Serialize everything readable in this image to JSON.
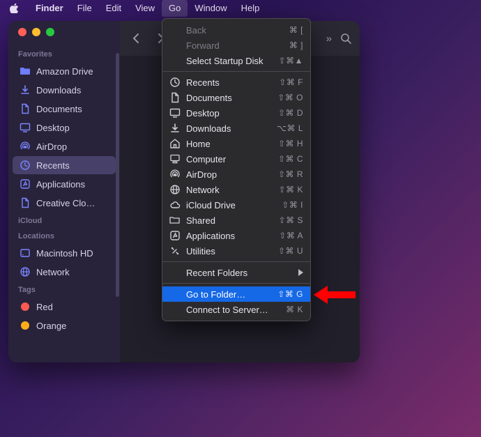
{
  "menubar": {
    "app": "Finder",
    "items": [
      "File",
      "Edit",
      "View",
      "Go",
      "Window",
      "Help"
    ],
    "open": "Go"
  },
  "sidebar": {
    "sections": [
      {
        "title": "Favorites",
        "items": [
          {
            "label": "Amazon Drive",
            "icon": "folder"
          },
          {
            "label": "Downloads",
            "icon": "download"
          },
          {
            "label": "Documents",
            "icon": "document"
          },
          {
            "label": "Desktop",
            "icon": "desktop"
          },
          {
            "label": "AirDrop",
            "icon": "airdrop"
          },
          {
            "label": "Recents",
            "icon": "clock",
            "selected": true
          },
          {
            "label": "Applications",
            "icon": "app"
          },
          {
            "label": "Creative Clo…",
            "icon": "document"
          }
        ]
      },
      {
        "title": "iCloud",
        "items": []
      },
      {
        "title": "Locations",
        "items": [
          {
            "label": "Macintosh HD",
            "icon": "disk"
          },
          {
            "label": "Network",
            "icon": "network"
          }
        ]
      },
      {
        "title": "Tags",
        "items": [
          {
            "label": "Red",
            "icon": "tag",
            "color": "#ff5a52"
          },
          {
            "label": "Orange",
            "icon": "tag",
            "color": "#ffae1a"
          }
        ]
      }
    ]
  },
  "dropdown": {
    "groups": [
      [
        {
          "label": "Back",
          "shortcut": "⌘ [",
          "disabled": true,
          "icon": ""
        },
        {
          "label": "Forward",
          "shortcut": "⌘ ]",
          "disabled": true,
          "icon": ""
        },
        {
          "label": "Select Startup Disk",
          "shortcut": "⇧⌘▲",
          "icon": ""
        }
      ],
      [
        {
          "label": "Recents",
          "shortcut": "⇧⌘ F",
          "icon": "clock"
        },
        {
          "label": "Documents",
          "shortcut": "⇧⌘ O",
          "icon": "document"
        },
        {
          "label": "Desktop",
          "shortcut": "⇧⌘ D",
          "icon": "desktop"
        },
        {
          "label": "Downloads",
          "shortcut": "⌥⌘ L",
          "icon": "download"
        },
        {
          "label": "Home",
          "shortcut": "⇧⌘ H",
          "icon": "home"
        },
        {
          "label": "Computer",
          "shortcut": "⇧⌘ C",
          "icon": "computer"
        },
        {
          "label": "AirDrop",
          "shortcut": "⇧⌘ R",
          "icon": "airdrop"
        },
        {
          "label": "Network",
          "shortcut": "⇧⌘ K",
          "icon": "network"
        },
        {
          "label": "iCloud Drive",
          "shortcut": "⇧⌘ I",
          "icon": "icloud"
        },
        {
          "label": "Shared",
          "shortcut": "⇧⌘ S",
          "icon": "shared"
        },
        {
          "label": "Applications",
          "shortcut": "⇧⌘ A",
          "icon": "app"
        },
        {
          "label": "Utilities",
          "shortcut": "⇧⌘ U",
          "icon": "utilities"
        }
      ],
      [
        {
          "label": "Recent Folders",
          "shortcut": "",
          "icon": "",
          "submenu": true
        }
      ],
      [
        {
          "label": "Go to Folder…",
          "shortcut": "⇧⌘ G",
          "icon": "",
          "highlighted": true
        },
        {
          "label": "Connect to Server…",
          "shortcut": "⌘ K",
          "icon": ""
        }
      ]
    ]
  },
  "icons": {
    "folder": "􀈕",
    "download": "􀈄",
    "document": "􀈷",
    "desktop": "􀣰",
    "airdrop": "􀌮",
    "clock": "􀐫",
    "app": "􀑋",
    "disk": "􀤂",
    "network": "􀤆",
    "home": "􀎞",
    "computer": "􀙗",
    "icloud": "􀌋",
    "shared": "􀉤",
    "utilities": "􀥌"
  },
  "colors": {
    "accent": "#1568e6",
    "annotation": "#ff0000"
  }
}
